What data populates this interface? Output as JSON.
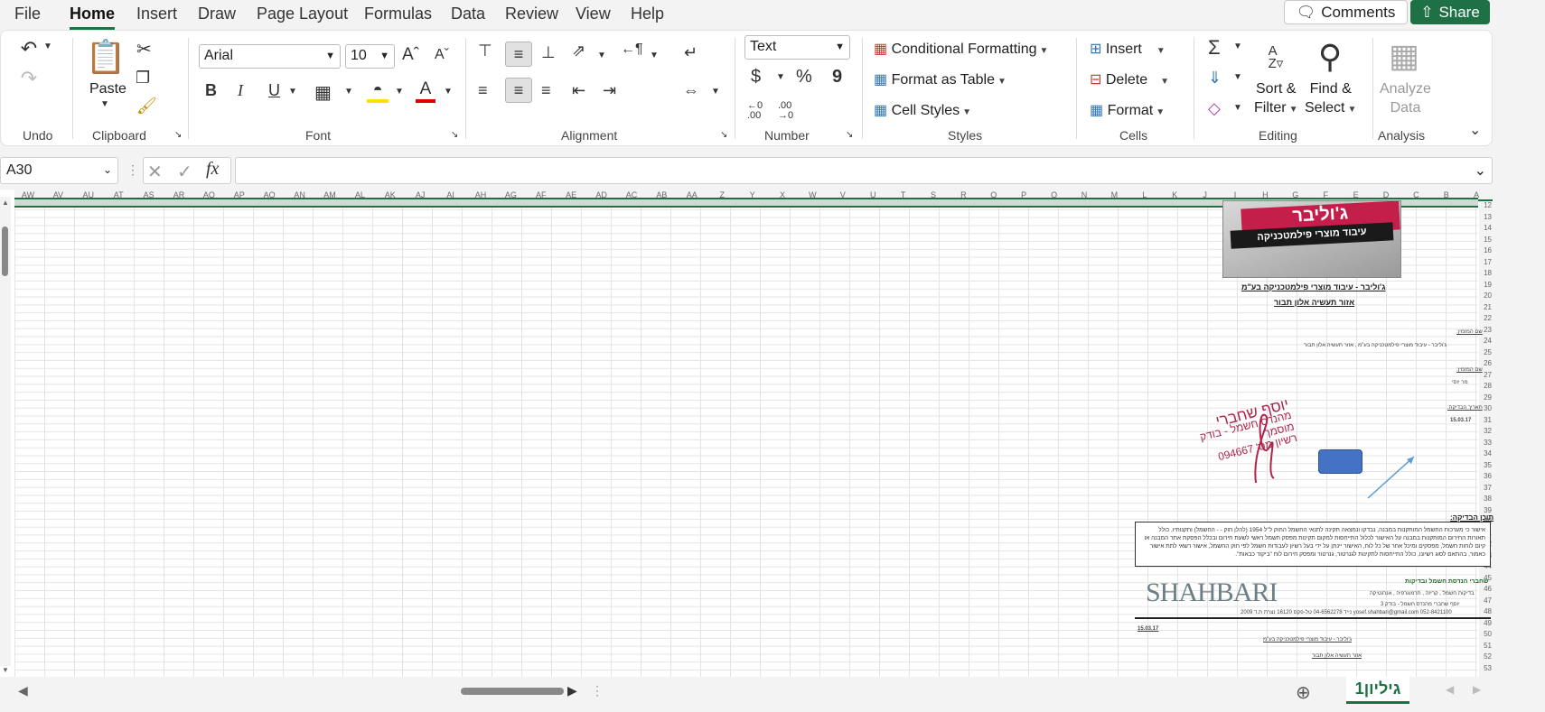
{
  "menu": {
    "items": [
      "File",
      "Home",
      "Insert",
      "Draw",
      "Page Layout",
      "Formulas",
      "Data",
      "Review",
      "View",
      "Help"
    ],
    "active": "Home",
    "comments_label": "Comments",
    "share_label": "Share"
  },
  "ribbon": {
    "undo_group": "Undo",
    "clipboard": {
      "paste_label": "Paste",
      "group": "Clipboard"
    },
    "font": {
      "name": "Arial",
      "size": "10",
      "group": "Font",
      "bold": "B",
      "italic": "I",
      "underline": "U"
    },
    "alignment": {
      "group": "Alignment"
    },
    "number": {
      "format": "Text",
      "group": "Number",
      "currency": "$",
      "percent": "%",
      "comma": "9",
      "inc_dec": ".00",
      "dec_dec": ".00"
    },
    "styles": {
      "conditional": "Conditional Formatting",
      "format_table": "Format as Table",
      "cell_styles": "Cell Styles",
      "group": "Styles"
    },
    "cells": {
      "insert": "Insert",
      "delete": "Delete",
      "format": "Format",
      "group": "Cells"
    },
    "editing": {
      "sort_line1": "Sort &",
      "sort_line2": "Filter",
      "find_line1": "Find &",
      "find_line2": "Select",
      "group": "Editing"
    },
    "analysis": {
      "line1": "Analyze",
      "line2": "Data",
      "group": "Analysis"
    }
  },
  "formula_bar": {
    "name_box": "A30",
    "fx": "fx",
    "value": ""
  },
  "columns": [
    "AW",
    "AV",
    "AU",
    "AT",
    "AS",
    "AR",
    "AQ",
    "AP",
    "AO",
    "AN",
    "AM",
    "AL",
    "AK",
    "AJ",
    "AI",
    "AH",
    "AG",
    "AF",
    "AE",
    "AD",
    "AC",
    "AB",
    "AA",
    "Z",
    "Y",
    "X",
    "W",
    "V",
    "U",
    "T",
    "S",
    "R",
    "Q",
    "P",
    "O",
    "N",
    "M",
    "L",
    "K",
    "J",
    "I",
    "H",
    "G",
    "F",
    "E",
    "D",
    "C",
    "B",
    "A"
  ],
  "rows": [
    "12",
    "13",
    "14",
    "15",
    "16",
    "17",
    "18",
    "19",
    "20",
    "21",
    "22",
    "23",
    "24",
    "25",
    "26",
    "27",
    "28",
    "29",
    "30",
    "31",
    "32",
    "33",
    "34",
    "35",
    "36",
    "37",
    "38",
    "39",
    "40",
    "41",
    "42",
    "43",
    "44",
    "45",
    "46",
    "47",
    "48",
    "49",
    "50",
    "51",
    "52",
    "53"
  ],
  "sheet": {
    "logo_top": "ג'וליבר",
    "logo_bottom": "עיבוד מוצרי פילמטכניקה",
    "title1": "ג'וליבר - עיבוד מוצרי פילמטכניקה בע\"מ",
    "title2": "אזור תעשיה אלון תבור",
    "label_client": "שם המזמין:",
    "client_value": "ג'וליבר - עיבוד מוצרי פילמטכניקה בע\"מ , אזור תעשיה אלון תבור",
    "label_contact": "שם המזמין:",
    "contact_value": "מר יוסי",
    "label_date": "תאריך הבדיקה:",
    "date": "15.03.17",
    "stamp_name": "יוסף שחברי",
    "stamp_title": "מהנדס חשמל - בודק מוסמך",
    "stamp_license": "רשיון מס' 094667",
    "section_title": "תוכן הבדיקה:",
    "body_text": "אישור כי מערכות החשמל המותקנות במבנה, נבדקו ונמצאה תקינה לתנאי החשמל החוק ל\"ל 1954 (להלן חוק - - החשמל) ותקנותיו, כולל תאורות החירום המותקנות במבנה על האישור לכלול התייחסות למקום תקינות מפסק חשמל ראשי לשעת חירום ובכלל הפסקת אתר המבנה או קיום לוחות חשמל, מפסקים ומיכל אחר של כל לוח, האישור יינתן על ידי בעל רשיון לעבודות חשמל לפי חוק החשמל, אישור רשאי לתת אישור כאמור, בהתאם לסוג רשיונו, כולל התייחסות לתקינות לגנרטור, גנרטור ומפסק חירום לוח \"ביקוד כבאות\".",
    "shahbari_logo": "SHAHBARI",
    "company_name": "שחברי הנדסת חשמל ובדיקות",
    "company_services": "בדיקות חשמל , קריזה , תרמוגרפיה , אנרגטיקה",
    "company_person": "יוסף שחברי מהנדס חשמל - בודק 3",
    "company_contact": "yosef.shahbari@gmail.com   052-8421100 נייד   04-6562278 טל-פקס   16120 נצרת ת.ד 2009",
    "footer_date": "15.03.17",
    "footer_title1": "ג'וליבר - עיבוד מוצרי פילמטכניקה בע\"מ",
    "footer_title2": "אזור תעשיה אלון תבור"
  },
  "sheet_tab": "גיליון1"
}
